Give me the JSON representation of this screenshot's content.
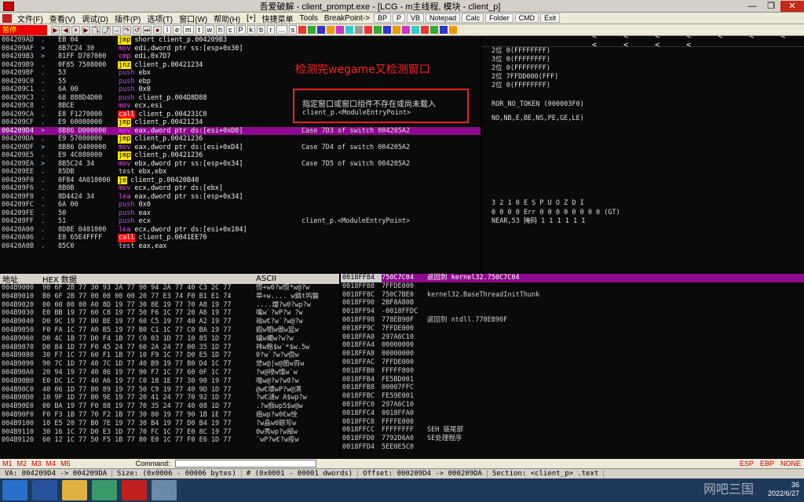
{
  "window": {
    "title": "吾爱破解 - client_prompt.exe - [LCG - m主线程, 模块 - client_p]",
    "min": "—",
    "max": "❐",
    "close": "✕"
  },
  "menu": {
    "items": [
      "文件(F)",
      "查看(V)",
      "调试(D)",
      "插件(P)",
      "选项(T)",
      "窗口(W)",
      "帮助(H)",
      "[+]",
      "快捷菜单",
      "Tools",
      "BreakPoint->"
    ],
    "tools": [
      "BP",
      "P",
      "VB",
      "Notepad",
      "Calc",
      "Folder",
      "CMD",
      "Exit"
    ]
  },
  "toolbar": {
    "status": "暂停",
    "letters": [
      "l",
      "e",
      "m",
      "t",
      "w",
      "h",
      "c",
      "P",
      "k",
      "b",
      "r",
      "...",
      "s"
    ]
  },
  "disasm": [
    {
      "a": "004209AD",
      "m": ".",
      "h": "EB 04",
      "mn": "jmp",
      "op": "short client_p.004209B3",
      "c": ""
    },
    {
      "a": "004209AF",
      "m": ">",
      "h": "8B7C24 30",
      "mn": "mov",
      "op": "edi,dword ptr ss:[esp+0x30]",
      "c": ""
    },
    {
      "a": "004209B3",
      "m": ">",
      "h": "81FF D707000",
      "mn": "cmp",
      "op": "edi,0x7D7",
      "c": ""
    },
    {
      "a": "004209B9",
      "m": ".",
      "h": "0F85 7508000",
      "mn": "jnz",
      "op": "client_p.00421234",
      "c": ""
    },
    {
      "a": "004209BF",
      "m": ".",
      "h": "53",
      "mn": "push",
      "op": "ebx",
      "c": ""
    },
    {
      "a": "004209C0",
      "m": ".",
      "h": "55",
      "mn": "push",
      "op": "ebp",
      "c": ""
    },
    {
      "a": "004209C1",
      "m": ".",
      "h": "6A 00",
      "mn": "push",
      "op": "0x0",
      "c": ""
    },
    {
      "a": "004209C3",
      "m": ".",
      "h": "68 888D4D00",
      "mn": "push",
      "op": "client_p.004D8D88",
      "c": ""
    },
    {
      "a": "004209C8",
      "m": ".",
      "h": "8BCE",
      "mn": "mov",
      "op": "ecx,esi",
      "c": ""
    },
    {
      "a": "004209CA",
      "m": ".",
      "h": "E8 F1270000",
      "mn": "call",
      "op": "client_p.004231C0",
      "c": ""
    },
    {
      "a": "004209CF",
      "m": ".",
      "h": "E9 60080000",
      "mn": "jmp",
      "op": "client_p.00421234",
      "c": ""
    },
    {
      "a": "004209D4",
      "m": ">",
      "h": "8B86 D000000",
      "mn": "mov",
      "op": "eax,dword ptr ds:[esi+0xD0]",
      "c": "Case 7D3 of switch 004205A2",
      "sel": true
    },
    {
      "a": "004209DA",
      "m": ".",
      "h": "E9 57080000",
      "mn": "jmp",
      "op": "client_p.00421236",
      "c": ""
    },
    {
      "a": "004209DF",
      "m": ">",
      "h": "8B86 D400000",
      "mn": "mov",
      "op": "eax,dword ptr ds:[esi+0xD4]",
      "c": "Case 7D4 of switch 004205A2"
    },
    {
      "a": "004209E5",
      "m": ".",
      "h": "E9 4C080000",
      "mn": "jmp",
      "op": "client_p.00421236",
      "c": ""
    },
    {
      "a": "004209EA",
      "m": ">",
      "h": "8B5C24 34",
      "mn": "mov",
      "op": "ebx,dword ptr ss:[esp+0x34]",
      "c": "Case 7D5 of switch 004205A2"
    },
    {
      "a": "004209EE",
      "m": ".",
      "h": "85DB",
      "mn": "test",
      "op": "ebx,ebx",
      "c": ""
    },
    {
      "a": "004209F0",
      "m": ".",
      "h": "0F84 4A010000",
      "mn": "je",
      "op": "client_p.00420B40",
      "c": ""
    },
    {
      "a": "004209F6",
      "m": ".",
      "h": "8B0B",
      "mn": "mov",
      "op": "ecx,dword ptr ds:[ebx]",
      "c": ""
    },
    {
      "a": "004209F8",
      "m": ".",
      "h": "8D4424 34",
      "mn": "lea",
      "op": "eax,dword ptr ss:[esp+0x34]",
      "c": ""
    },
    {
      "a": "004209FC",
      "m": ".",
      "h": "6A 00",
      "mn": "push",
      "op": "0x0",
      "c": ""
    },
    {
      "a": "004209FE",
      "m": ".",
      "h": "50",
      "mn": "push",
      "op": "eax",
      "c": ""
    },
    {
      "a": "004209FF",
      "m": ".",
      "h": "51",
      "mn": "push",
      "op": "ecx",
      "c": "client_p.<ModuleEntryPoint>"
    },
    {
      "a": "00420A00",
      "m": ".",
      "h": "8D8E 0401000",
      "mn": "lea",
      "op": "ecx,dword ptr ds:[esi+0x104]",
      "c": ""
    },
    {
      "a": "00420A06",
      "m": ".",
      "h": "E8 65E4FFFF",
      "mn": "call",
      "op": "client_p.0041EE70",
      "c": ""
    },
    {
      "a": "00420A0B",
      "m": ".",
      "h": "85C0",
      "mn": "test",
      "op": "eax,eax",
      "c": ""
    }
  ],
  "annotation": {
    "red_note": "检测完wegame又检测窗口",
    "box_line1": "指定窗口或窗口组件不存在或尚未载入",
    "box_line2": "client_p.<ModuleEntryPoint>"
  },
  "regs": {
    "arrows": "< < < < < < < < < < <",
    "lines": [
      "2位 0(FFFFFFFF)",
      "3位 0(FFFFFFFF)",
      "2位 0(FFFFFFFF)",
      "2位 7FFDD000(FFF)",
      "2位 0(FFFFFFFF)",
      "ROR_NO_TOKEN (000003F0)",
      "NO,NB,E,BE,NS,PE,GE,LE)",
      "3 2 1 0      E S P U O Z D I",
      "0 0 0 0  Err 0 0 0 0 0 0 0 0  (GT)",
      "NEAR,53  掩码     1 1 1 1 1 1"
    ],
    "fst_hl": "0"
  },
  "hex": {
    "headers": [
      "地址",
      "HEX 数据",
      "ASCII"
    ],
    "rows": [
      {
        "a": "004B9000",
        "b": "90 6F 2B 77 30 93 2A 77 90 94 2A 77 40 C3 2C 77",
        "s": "恒+w0?w恨*w@?w"
      },
      {
        "a": "004B9010",
        "b": "B0 6F 2B 77 00 00 00 00 20 77 E3 74 F0 B1 E1 74",
        "s": "旱+w.... w鎮t鸨醫"
      },
      {
        "a": "004B9020",
        "b": "00 00 00 00 A0 8D 19 77 30 8E 19 77 70 A8 19 77",
        "s": "....爧?w0?wp?w"
      },
      {
        "a": "004B9030",
        "b": "E0 BB 19 77 60 C8 19 77 50 F6 1C 77 20 A6 19 77",
        "s": "噙w`?wP?w ?w"
      },
      {
        "a": "004B9040",
        "b": "D0 9C 19 77 80 BE 19 77 60 C5 19 77 40 A2 19 77",
        "s": "袦w€?w`?w@?w"
      },
      {
        "a": "004B9050",
        "b": "F0 FA 1C 77 A0 B5 19 77 B0 C1 1C 77 C0 BA 19 77",
        "s": "瘕w牭w傲w篮w"
      },
      {
        "a": "004B9060",
        "b": "D0 4C 1B 77 D0 F4 1B 77 C0 03 1D 77 10 85 1D 77",
        "s": "蠰w蠅w?w?w"
      },
      {
        "a": "004B9070",
        "b": "D0 84 1D 77 F0 45 24 77 60 2A 24 77 00 35 1D 77",
        "s": "袆w餎$w`*$w.5w"
      },
      {
        "a": "004B9080",
        "b": "30 F7 1C 77 60 F1 1B 77 10 F9 1C 77 D0 E5 1D 77",
        "s": "0?w`?w?w佷w"
      },
      {
        "a": "004B9090",
        "b": "90 7C 1D 77 40 7C 1D 77 40 B9 19 77 B0 D4 1C 77",
        "s": "恷w@|w@箇w百w"
      },
      {
        "a": "004B90A0",
        "b": "20 94 19 77 40 86 19 77 90 F7 1C 77 60 0F 1C 77",
        "s": " ?w@唚w愭w`w"
      },
      {
        "a": "004B90B0",
        "b": "E0 DC 1C 77 40 A6 19 77 C0 18 1E 77 30 90 19 77",
        "s": "噜w@?w?w0?w"
      },
      {
        "a": "004B90C0",
        "b": "40 06 1D 77 80 89 19 77 50 C9 19 77 40 9D 1D 77",
        "s": "@w€墂wP?w@漺"
      },
      {
        "a": "004B90D0",
        "b": "10 9F 1D 77 80 9E 19 77 20 41 24 77 70 92 1D 77",
        "s": "?w€瀢w A$wp?w"
      },
      {
        "a": "004B90E0",
        "b": "00 BA 19 77 F0 88 19 77 70 35 24 77 40 08 1D 77",
        "s": ".?w痂wp5$w@w"
      },
      {
        "a": "004B90F0",
        "b": "F0 F3 1B 77 70 F2 1B 77 30 80 19 77 90 1B 1E 77",
        "s": "痼wp?w0€w恮"
      },
      {
        "a": "004B9100",
        "b": "10 E5 20 77 B0 7E 19 77 30 B4 19 77 D0 B4 19 77",
        "s": "?w皛w0磜写w"
      },
      {
        "a": "004B9110",
        "b": "30 16 1C 77 D0 E3 1D 77 70 FC 1C 77 E0 8C 19 77",
        "s": "0w秀wp?w鄬w"
      },
      {
        "a": "004B9120",
        "b": "60 12 1C 77 50 F5 1B 77 80 E0 1C 77 F0 E6 1D 77",
        "s": "`wP?w€?w痊w"
      }
    ]
  },
  "stack": [
    {
      "a": "0018FF84",
      "v": "750C7C04",
      "c": "返回到 kernel32.750C7C04",
      "top": true
    },
    {
      "a": "0018FF88",
      "v": "7FFDE000",
      "c": ""
    },
    {
      "a": "0018FF8C",
      "v": "750C7BE0",
      "c": "kernel32.BaseThreadInitThunk"
    },
    {
      "a": "0018FF90",
      "v": "2BF8A80B",
      "c": ""
    },
    {
      "a": "0018FF94",
      "v": "-0018FFDC",
      "c": ""
    },
    {
      "a": "0018FF98",
      "v": "778EB90F",
      "c": "返回到 ntdll.778EB90F"
    },
    {
      "a": "0018FF9C",
      "v": "7FFDE000",
      "c": ""
    },
    {
      "a": "0018FFA0",
      "v": "297A6C10",
      "c": ""
    },
    {
      "a": "0018FFA4",
      "v": "00000000",
      "c": ""
    },
    {
      "a": "0018FFA8",
      "v": "00000000",
      "c": ""
    },
    {
      "a": "0018FFAC",
      "v": "7FFDE000",
      "c": ""
    },
    {
      "a": "0018FFB0",
      "v": "FFFFF800",
      "c": ""
    },
    {
      "a": "0018FFB4",
      "v": "FE5BD001",
      "c": ""
    },
    {
      "a": "0018FFB8",
      "v": "00007FFC",
      "c": ""
    },
    {
      "a": "0018FFBC",
      "v": "FE59E001",
      "c": ""
    },
    {
      "a": "0018FFC0",
      "v": "297A6C10",
      "c": ""
    },
    {
      "a": "0018FFC4",
      "v": "0018FFA0",
      "c": ""
    },
    {
      "a": "0018FFC8",
      "v": "FFFFE000",
      "c": ""
    },
    {
      "a": "0018FFCC",
      "v": "FFFFFFFF",
      "c": "SEH 链尾部"
    },
    {
      "a": "0018FFD0",
      "v": "7792D6A0",
      "c": "SE处理程序"
    },
    {
      "a": "0018FFD4",
      "v": "5EE0E5C0",
      "c": ""
    }
  ],
  "cmdbar": {
    "tabs": [
      "M1",
      "M2",
      "M3",
      "M4",
      "M5"
    ],
    "label": "Command:",
    "right": [
      "ESP",
      "EBP",
      "NONE"
    ]
  },
  "statusbar": [
    "VA: 004209D4 -> 004209DA",
    "Size: (0x0006 - 00006 bytes)",
    "#  (0x0001 - 00001 dwords)",
    "Offset: 000209D4 -> 000209DA",
    "Section: <client_p> .text"
  ],
  "taskbar": {
    "time": "36",
    "date": "2022/6/27",
    "watermark": "网吧三国"
  }
}
